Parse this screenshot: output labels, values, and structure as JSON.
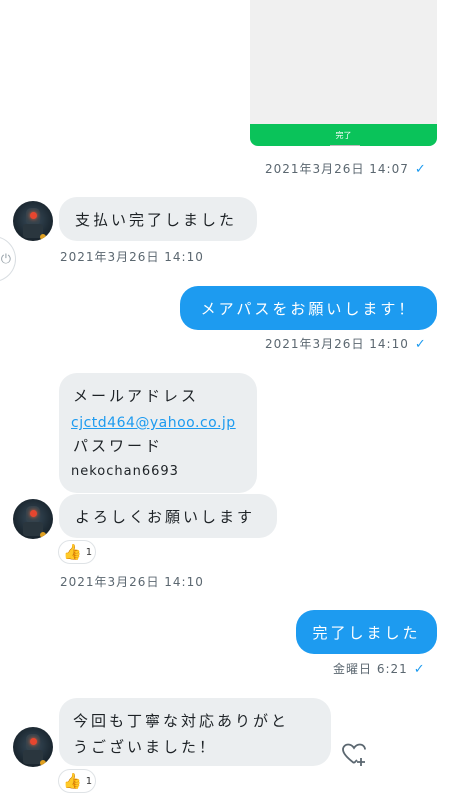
{
  "image_attachment": {
    "button_label": "完了"
  },
  "messages": [
    {
      "id": "m1",
      "timestamp": "2021年3月26日 14:07",
      "read": true
    },
    {
      "id": "m2",
      "text": "支払い完了しました",
      "timestamp": "2021年3月26日 14:10"
    },
    {
      "id": "m3",
      "text": "メアパスをお願いします！",
      "timestamp": "2021年3月26日 14:10",
      "read": true
    },
    {
      "id": "m4",
      "lines": [
        "メールアドレス",
        "cjctd464@yahoo.co.jp",
        "パスワード",
        "nekochan6693"
      ]
    },
    {
      "id": "m5",
      "text": "よろしくお願いします",
      "reaction_count": "1",
      "timestamp": "2021年3月26日 14:10"
    },
    {
      "id": "m6",
      "text": "完了しました",
      "timestamp": "金曜日 6:21",
      "read": true
    },
    {
      "id": "m7",
      "lines": [
        "今回も丁寧な対応ありがと",
        "うございました！"
      ],
      "reaction_count": "1"
    }
  ],
  "icons": {
    "check": "✓",
    "side_button": "power-icon",
    "thumbs_up": "👍",
    "heart_plus": "heart-plus-icon"
  },
  "colors": {
    "accent": "#1d9bf0",
    "bubble_in": "#ebeef0",
    "green": "#0ac35a"
  }
}
